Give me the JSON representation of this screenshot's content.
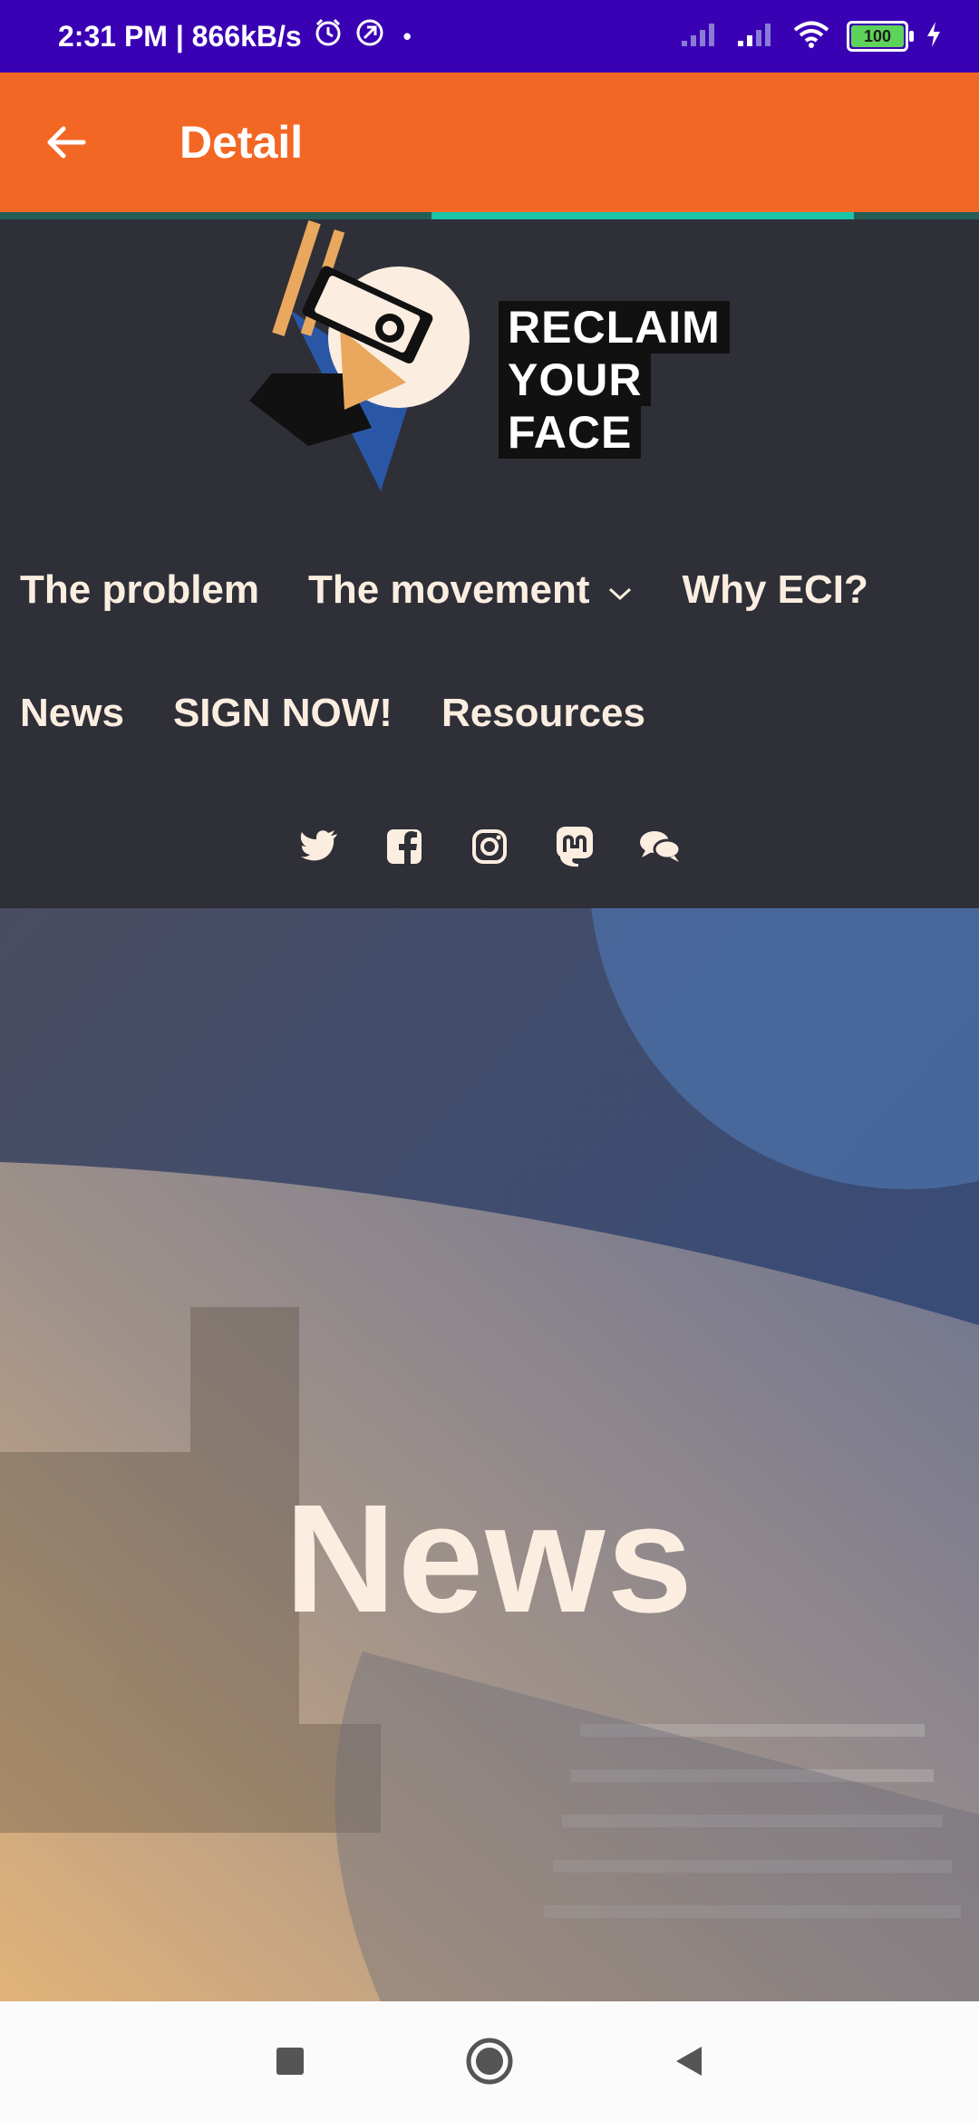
{
  "status_bar": {
    "time_speed": "2:31 PM | 866kB/s",
    "dot": "•",
    "battery": "100"
  },
  "app_bar": {
    "title": "Detail"
  },
  "load_progress": 0.5,
  "site": {
    "logo_text": [
      "RECLAIM",
      "YOUR",
      "FACE"
    ],
    "nav": {
      "row1": [
        "The problem",
        "The movement",
        "Why ECI?"
      ],
      "row2": [
        "News",
        "SIGN NOW!",
        "Resources"
      ]
    },
    "social_icons": [
      "twitter-icon",
      "facebook-icon",
      "instagram-icon",
      "mastodon-icon",
      "chat-icon"
    ]
  },
  "hero": {
    "title": "News"
  },
  "colors": {
    "status_bar": "#3a00b3",
    "app_bar": "#f36724",
    "progress": "#19c4a9",
    "site_header": "#2f2f38",
    "nav_text": "#fbeee0"
  }
}
